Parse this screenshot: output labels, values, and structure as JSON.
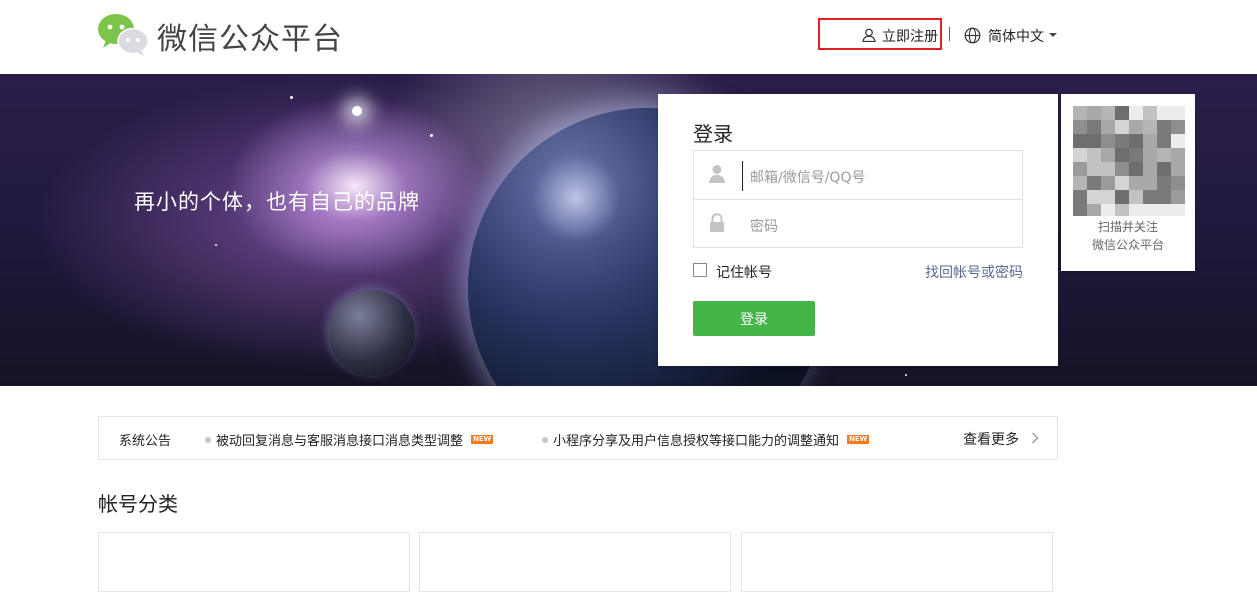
{
  "header": {
    "logo_text": "微信公众平台",
    "register_label": "立即注册",
    "language_label": "简体中文",
    "icons": [
      "wechat-logo-icon",
      "user-outline-icon",
      "globe-icon",
      "caret-down-icon"
    ]
  },
  "banner": {
    "slogan": "再小的个体，也有自己的品牌"
  },
  "login": {
    "title": "登录",
    "account_placeholder": "邮箱/微信号/QQ号",
    "password_placeholder": "密码",
    "remember_label": "记住帐号",
    "forgot_link": "找回帐号或密码",
    "submit_label": "登录",
    "submit_color": "#44b549",
    "icons": [
      "user-icon",
      "lock-icon"
    ]
  },
  "qr": {
    "caption_line1": "扫描并关注",
    "caption_line2": "微信公众平台"
  },
  "notice": {
    "title": "系统公告",
    "items": [
      {
        "text": "被动回复消息与客服消息接口消息类型调整",
        "badge": "NEW"
      },
      {
        "text": "小程序分享及用户信息授权等接口能力的调整通知",
        "badge": "NEW"
      }
    ],
    "more_label": "查看更多"
  },
  "categories": {
    "title": "帐号分类"
  },
  "colors": {
    "accent_green": "#44b549",
    "link_blue": "#576b95",
    "highlight_red": "#e02020",
    "badge_orange": "#f37b1d"
  }
}
